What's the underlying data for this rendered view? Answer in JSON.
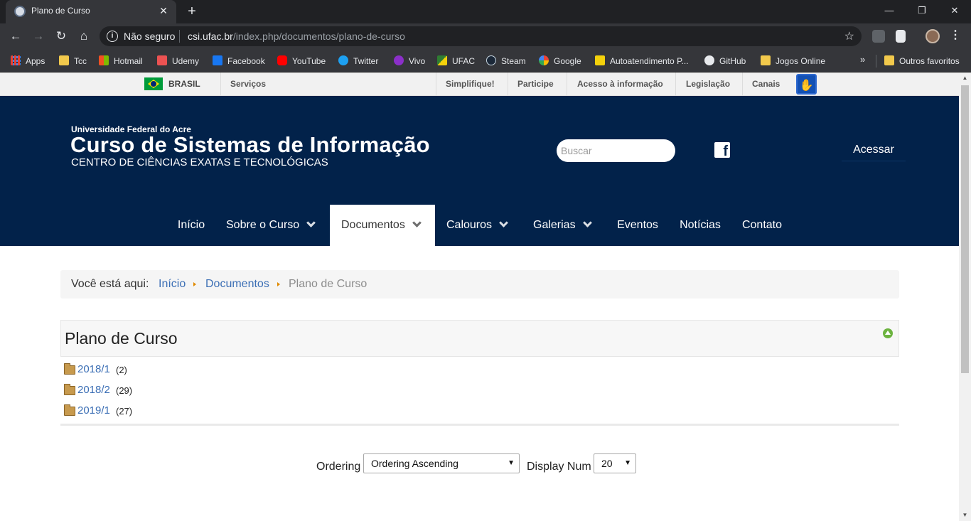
{
  "browser": {
    "tab_title": "Plano de Curso",
    "tab_close": "✕",
    "new_tab": "+",
    "window_controls": [
      "—",
      "❐",
      "✕"
    ],
    "security_label": "Não seguro",
    "url_host": "csi.ufac.br",
    "url_path": "/index.php/documentos/plano-de-curso",
    "bookmarks": [
      {
        "label": "Apps",
        "color": "#e8eaed"
      },
      {
        "label": "Tcc",
        "color": "#f2c94c"
      },
      {
        "label": "Hotmail",
        "color": "#f25022"
      },
      {
        "label": "Udemy",
        "color": "#ec5252"
      },
      {
        "label": "Facebook",
        "color": "#1877f2"
      },
      {
        "label": "YouTube",
        "color": "#ff0000"
      },
      {
        "label": "Twitter",
        "color": "#1da1f2"
      },
      {
        "label": "Vivo",
        "color": "#8b2fc9"
      },
      {
        "label": "UFAC",
        "color": "#2f7d32"
      },
      {
        "label": "Steam",
        "color": "#c7d5e0"
      },
      {
        "label": "Google",
        "color": "#ffffff"
      },
      {
        "label": "Autoatendimento P...",
        "color": "#f4d10b"
      },
      {
        "label": "GitHub",
        "color": "#e8eaed"
      },
      {
        "label": "Jogos Online",
        "color": "#f2c94c"
      }
    ],
    "bookmarks_more": "»",
    "other_bookmarks": "Outros favoritos"
  },
  "govbar": {
    "country": "BRASIL",
    "services": "Serviços",
    "links": [
      "Simplifique!",
      "Participe",
      "Acesso à informação",
      "Legislação",
      "Canais"
    ],
    "accessibility_icon": "libras-icon"
  },
  "header": {
    "university": "Universidade Federal do Acre",
    "course": "Curso de Sistemas de Informação",
    "center": "CENTRO DE CIÊNCIAS EXATAS E TECNOLÓGICAS",
    "search_placeholder": "Buscar",
    "facebook": "f",
    "login": "Acessar"
  },
  "menu": [
    {
      "label": "Início",
      "dropdown": false
    },
    {
      "label": "Sobre o Curso",
      "dropdown": true
    },
    {
      "label": "Documentos",
      "dropdown": true,
      "active": true
    },
    {
      "label": "Calouros",
      "dropdown": true
    },
    {
      "label": "Galerias",
      "dropdown": true
    },
    {
      "label": "Eventos",
      "dropdown": false
    },
    {
      "label": "Notícias",
      "dropdown": false
    },
    {
      "label": "Contato",
      "dropdown": false
    }
  ],
  "breadcrumb": {
    "label": "Você está aqui:",
    "items": [
      "Início",
      "Documentos"
    ],
    "current": "Plano de Curso"
  },
  "docman": {
    "title": "Plano de Curso",
    "folders": [
      {
        "name": "2018/1",
        "count": "(2)"
      },
      {
        "name": "2018/2",
        "count": "(29)"
      },
      {
        "name": "2019/1",
        "count": "(27)"
      }
    ],
    "ordering_label": "Ordering",
    "ordering_value": "Ordering Ascending",
    "display_label": "Display Num",
    "display_value": "20"
  },
  "colors": {
    "header_bg": "#02224a",
    "link": "#3c6fb5",
    "breadcrumb_arrow": "#e08a00"
  }
}
